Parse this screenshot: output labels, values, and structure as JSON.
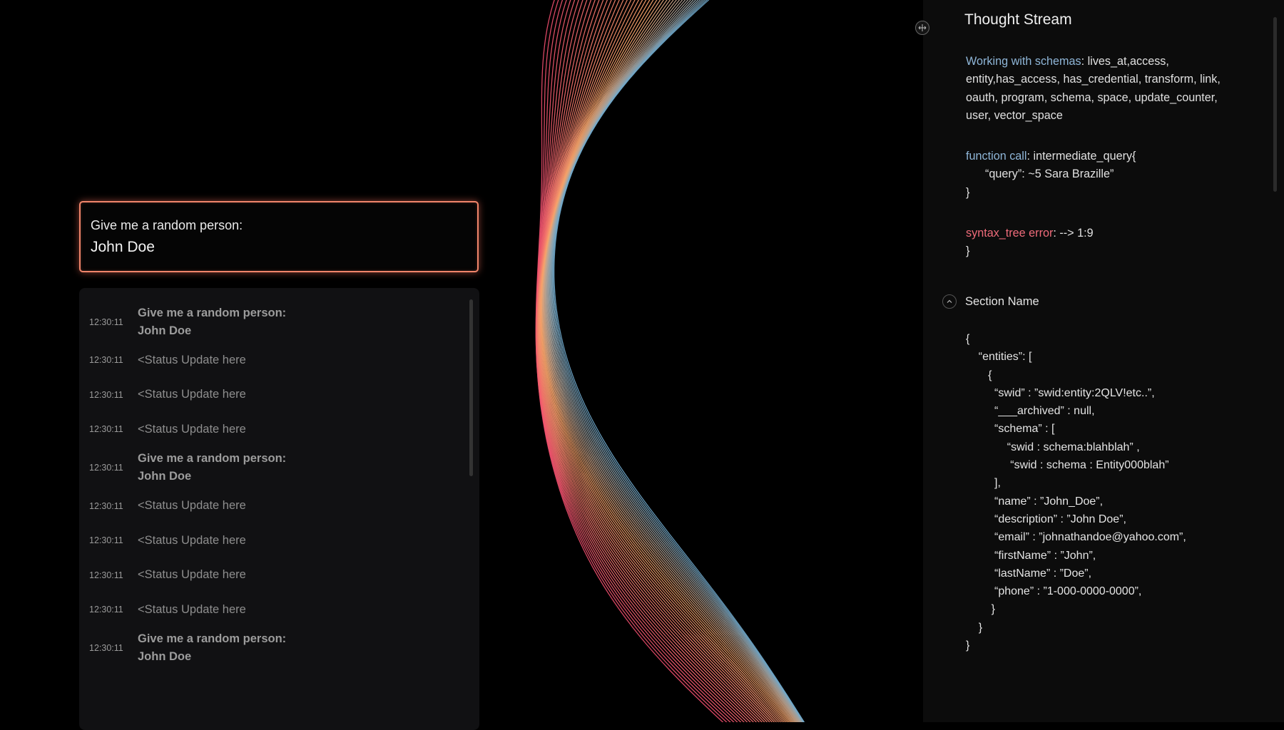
{
  "prompt_box": {
    "label": "Give me a random person:",
    "value": "John Doe"
  },
  "log": {
    "items": [
      {
        "time": "12:30:11",
        "type": "prompt",
        "text": "Give me a random person:",
        "text2": "John Doe"
      },
      {
        "time": "12:30:11",
        "type": "status",
        "text": "<Status Update here"
      },
      {
        "time": "12:30:11",
        "type": "status",
        "text": "<Status Update here"
      },
      {
        "time": "12:30:11",
        "type": "status",
        "text": "<Status Update here"
      },
      {
        "time": "12:30:11",
        "type": "prompt",
        "text": "Give me a random person:",
        "text2": "John Doe"
      },
      {
        "time": "12:30:11",
        "type": "status",
        "text": "<Status Update here"
      },
      {
        "time": "12:30:11",
        "type": "status",
        "text": "<Status Update here"
      },
      {
        "time": "12:30:11",
        "type": "status",
        "text": "<Status Update here"
      },
      {
        "time": "12:30:11",
        "type": "status",
        "text": "<Status Update here"
      },
      {
        "time": "12:30:11",
        "type": "prompt",
        "text": "Give me a random person:",
        "text2": "John Doe"
      }
    ]
  },
  "thought_stream": {
    "title": "Thought Stream",
    "schemas_label": "Working with schemas",
    "schemas_sep": ":",
    "schemas_value": " lives_at,access, entity,has_access, has_credential, transform, link, oauth, program, schema, space, update_counter, user, vector_space",
    "function_label": "function call",
    "function_sep": ":",
    "function_value": " intermediate_query{",
    "function_query": "      “query”: ~5 Sara Brazille”",
    "function_close": "}",
    "error_label": "syntax_tree error",
    "error_sep": ":",
    "error_value": " --> 1:9",
    "error_close": "}",
    "section_name": "Section Name",
    "json_lines": [
      "{",
      "    “entities”: [",
      "       {",
      "         “swid” : ”swid:entity:2QLV!etc..”,",
      "         “___archived” : null,",
      "         “schema” : [",
      "             “swid : schema:blahblah” ,",
      "              “swid : schema : Entity000blah”",
      "         ],",
      "         “name” : ”John_Doe”,",
      "         “description” : ”John Doe”,",
      "         “email” : ”johnathandoe@yahoo.com”,",
      "         “firstName” : ”John”,",
      "         “lastName” : ”Doe”,",
      "         “phone” : ”1-000-0000-0000”,",
      "        }",
      "    }",
      "}"
    ]
  },
  "colors": {
    "accent_orange": "#f0856a",
    "wave_red": "#f04e6e",
    "wave_orange": "#f7a46a",
    "wave_blue": "#6fa8cc",
    "label_blue": "#8fb6d8",
    "error_red": "#ef6b7a"
  },
  "icons": {
    "resize_handle": "resize-arrows-icon",
    "section_toggle": "chevron-up-icon"
  }
}
